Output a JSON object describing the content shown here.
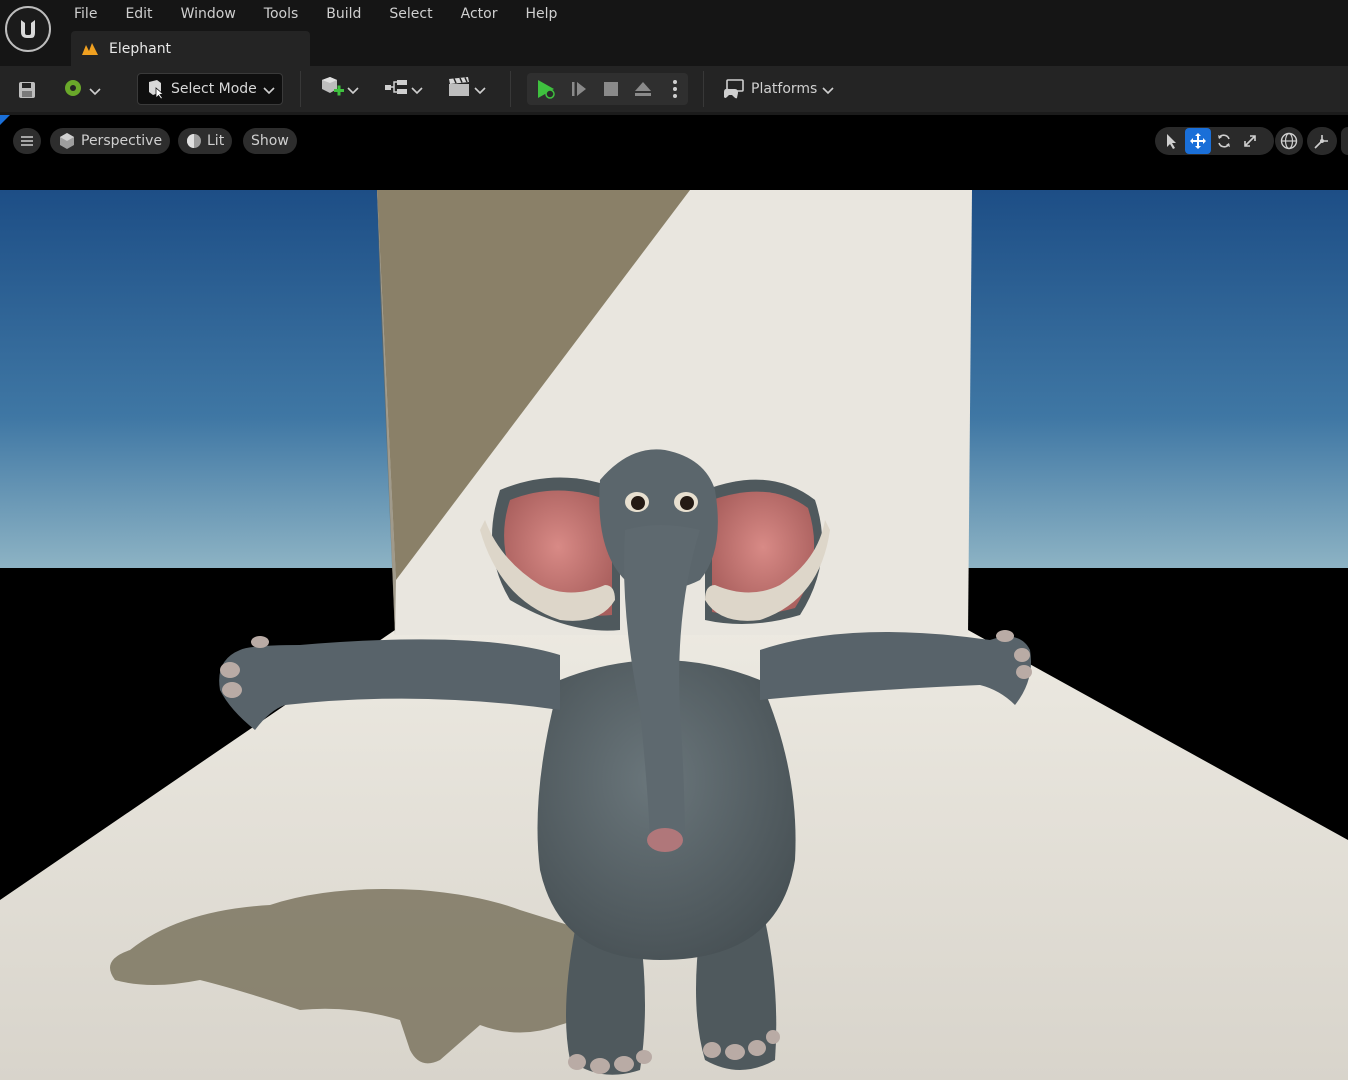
{
  "menubar": {
    "items": [
      "File",
      "Edit",
      "Window",
      "Tools",
      "Build",
      "Select",
      "Actor",
      "Help"
    ]
  },
  "document_tab": {
    "title": "Elephant"
  },
  "toolbar": {
    "select_mode_label": "Select Mode",
    "platforms_label": "Platforms"
  },
  "viewport_toolbar": {
    "perspective_label": "Perspective",
    "lit_label": "Lit",
    "show_label": "Show"
  },
  "colors": {
    "accent": "#1a6fd8",
    "play_green": "#3fc13f",
    "sky_top": "#1d4e86",
    "sky_horizon": "#8db3c4",
    "elephant_gray": "#515c61",
    "ear_pink": "#c97a78",
    "floor": "#dddad2"
  },
  "icons": [
    "unreal-logo-icon",
    "level-icon",
    "save-icon",
    "source-control-icon",
    "select-mode-icon",
    "add-actor-icon",
    "blueprint-icon",
    "cinematics-icon",
    "play-icon",
    "advance-frame-icon",
    "stop-icon",
    "eject-icon",
    "more-options-icon",
    "platforms-icon",
    "hamburger-icon",
    "perspective-cube-icon",
    "lit-sphere-icon",
    "select-tool-icon",
    "translate-tool-icon",
    "rotate-tool-icon",
    "scale-tool-icon",
    "world-space-icon",
    "surface-snap-icon"
  ]
}
